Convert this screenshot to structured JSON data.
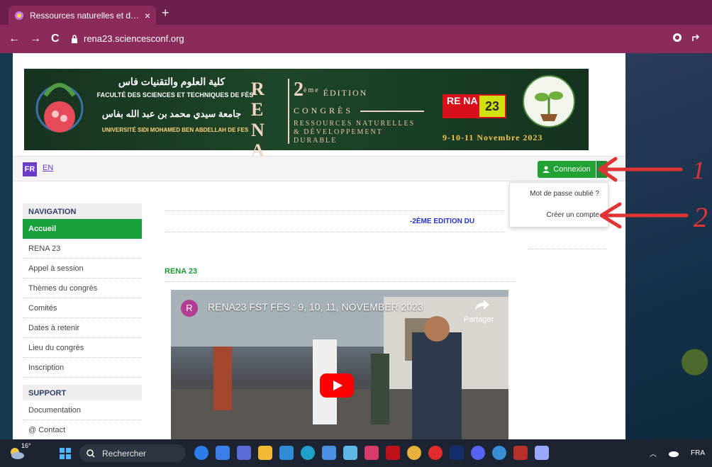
{
  "browser": {
    "tab_title": "Ressources naturelles et développ",
    "new_tab_symbol": "+",
    "close_symbol": "×",
    "url": "rena23.sciencesconf.org",
    "nav": {
      "back": "←",
      "forward": "→",
      "reload": "C"
    }
  },
  "banner": {
    "faculty_ar": "كلية العلوم والتقنيات فاس",
    "faculty_fr": "FACULTÉ DES SCIENCES ET TECHNIQUES DE FÈS",
    "university_ar": "جامعة سيدي محمد بن عبد الله بفاس",
    "university_fr": "UNIVERSITÉ SIDI MOHAMED BEN ABDELLAH DE FES",
    "rena_letters": [
      "R E",
      "N A",
      "2 3"
    ],
    "edition_num": "2",
    "edition_sup": "ème",
    "edition_text": "ÉDITION",
    "congres": "CONGRÈS",
    "theme_lines": [
      "RESSOURCES NATURELLES",
      "& DÉVELOPPEMENT",
      "DURABLE"
    ],
    "logo_rena": "RE NA",
    "logo_23": "23",
    "dates": "9-10-11 Novembre 2023"
  },
  "topbar": {
    "lang_fr": "FR",
    "lang_en": "EN",
    "connexion_label": "Connexion",
    "dropdown_items": [
      "Mot de passe oublié ?",
      "Créer un compte"
    ]
  },
  "sidebar": {
    "nav_heading": "NAVIGATION",
    "items": [
      "Accueil",
      "RENA 23",
      "Appel à session",
      "Thèmes du congrès",
      "Comités",
      "Dates à retenir",
      "Lieu du congrès",
      "Inscription"
    ],
    "support_heading": "SUPPORT",
    "support_items": [
      "Documentation",
      "@ Contact"
    ]
  },
  "main": {
    "marquee": "-2ÈME EDITION DU",
    "section_heading": "RENA 23",
    "video": {
      "channel_initial": "R",
      "title": "RENA23 FST FES : 9, 10, 11, NOVEMBER 2023",
      "share_label": "Partager"
    }
  },
  "annotations": {
    "one": "1",
    "two": "2"
  },
  "taskbar": {
    "temperature": "16°",
    "search_placeholder": "Rechercher",
    "language": "FRA"
  }
}
